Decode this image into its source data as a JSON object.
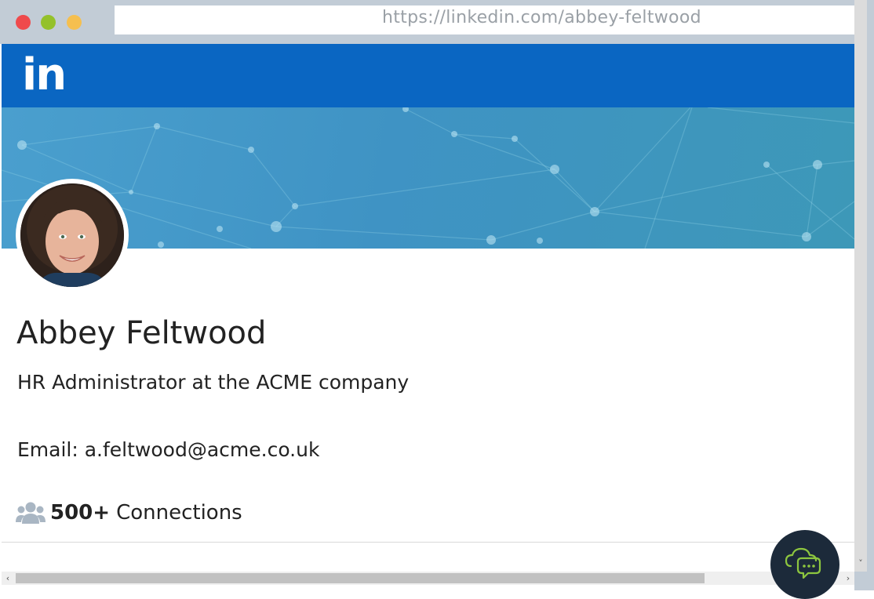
{
  "browser": {
    "url": "https://linkedin.com/abbey-feltwood",
    "window_buttons": [
      "close",
      "minimize",
      "maximize"
    ]
  },
  "header": {
    "logo": "in",
    "brand_color": "#0a66c2"
  },
  "profile": {
    "name": "Abbey Feltwood",
    "headline": "HR Administrator at the ACME company",
    "email": "Email: a.feltwood@acme.co.uk",
    "connections_count": "500+",
    "connections_label": "Connections",
    "connections_icon": "users-icon",
    "avatar_icon": "profile-photo"
  },
  "chat": {
    "icon": "cloud-chat-icon",
    "accent_color": "#8dc63f"
  },
  "scrollbars": {
    "left_arrow": "‹",
    "right_arrow": "›",
    "down_arrow": "˅"
  }
}
